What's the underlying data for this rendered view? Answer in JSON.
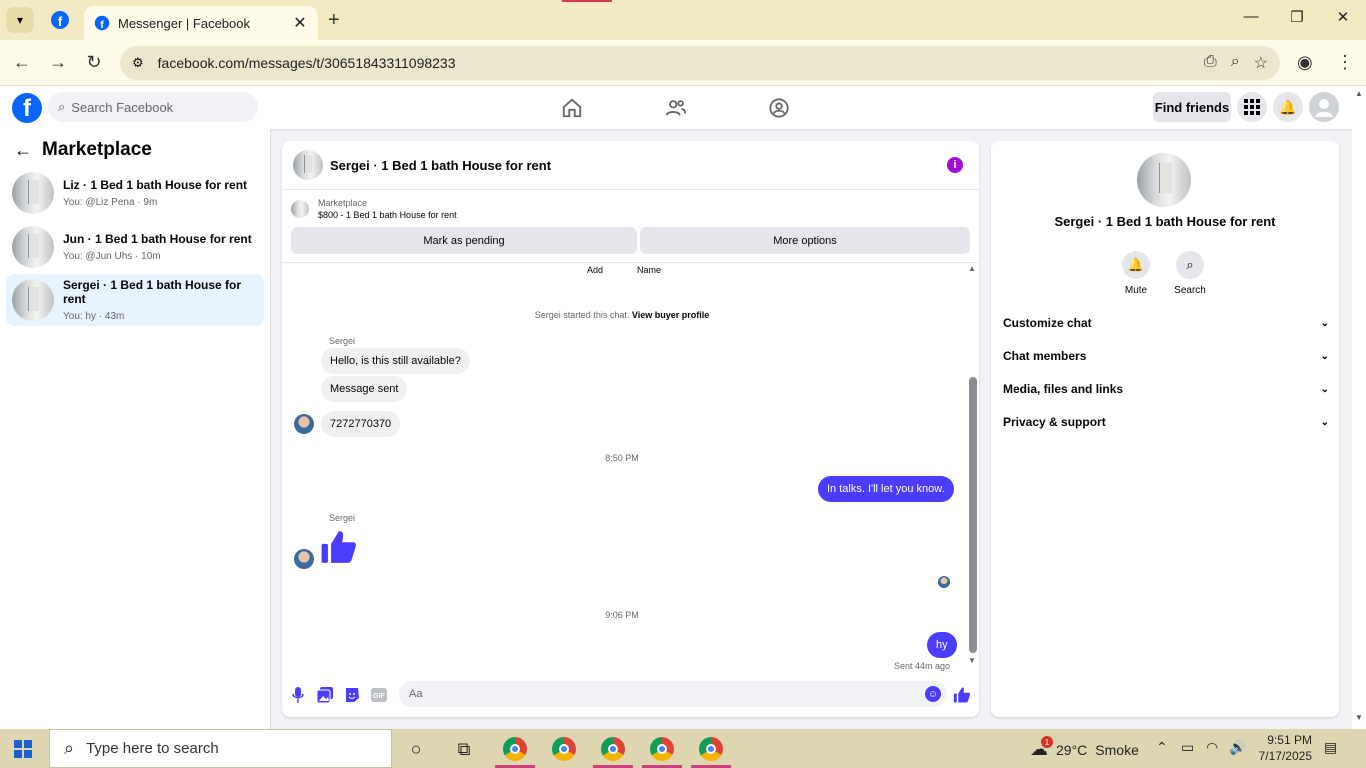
{
  "browser": {
    "tab_title": "Messenger | Facebook",
    "url": "facebook.com/messages/t/30651843311098233"
  },
  "fb_header": {
    "search_placeholder": "Search Facebook",
    "find_friends": "Find friends"
  },
  "sidebar": {
    "title": "Marketplace",
    "conversations": [
      {
        "title": "Liz · 1 Bed 1 bath House for rent",
        "preview": "You: @Liz Pena · 9m",
        "active": false
      },
      {
        "title": "Jun · 1 Bed 1 bath House for rent",
        "preview": "You: @Jun Uhs · 10m",
        "active": false
      },
      {
        "title": "Sergei · 1 Bed 1 bath House for rent",
        "preview": "You: hy · 43m",
        "active": true
      }
    ]
  },
  "chat": {
    "title": "Sergei · 1 Bed 1 bath House for rent",
    "marketplace_label": "Marketplace",
    "listing": "$800 - 1 Bed 1 bath House for rent",
    "mark_pending": "Mark as pending",
    "more_options": "More options",
    "add_label": "Add",
    "name_label": "Name",
    "system_text": "Sergei started this chat.",
    "view_profile": "View buyer profile",
    "sender_name_1": "Sergei",
    "msg_1": "Hello, is this still available?",
    "msg_2": "Message sent",
    "msg_3": "7272770370",
    "time_1": "8:50 PM",
    "msg_out_1": "In talks. I'll let you know.",
    "sender_name_2": "Sergei",
    "time_2": "9:06 PM",
    "msg_out_2": "hy",
    "sent_status": "Sent 44m ago",
    "input_placeholder": "Aa"
  },
  "details": {
    "name": "Sergei · 1 Bed 1 bath House for rent",
    "mute": "Mute",
    "search": "Search",
    "sections": [
      "Customize chat",
      "Chat members",
      "Media, files and links",
      "Privacy & support"
    ]
  },
  "taskbar": {
    "search_placeholder": "Type here to search",
    "temp": "29°C",
    "weather": "Smoke",
    "time": "9:51 PM",
    "date": "7/17/2025",
    "notification_count": "1"
  }
}
